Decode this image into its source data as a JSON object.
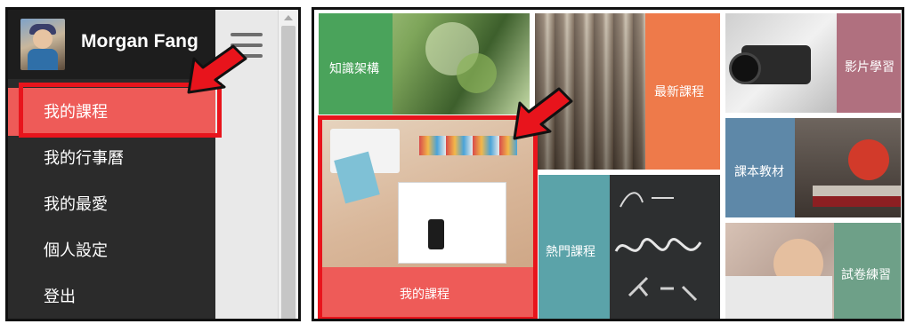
{
  "user": {
    "name": "Morgan Fang"
  },
  "menu": {
    "items": [
      {
        "label": "我的課程",
        "active": true
      },
      {
        "label": "我的行事曆",
        "active": false
      },
      {
        "label": "我的最愛",
        "active": false
      },
      {
        "label": "個人設定",
        "active": false
      },
      {
        "label": "登出",
        "active": false
      }
    ]
  },
  "tiles": {
    "knowledge": "知識架構",
    "new_courses": "最新課程",
    "video": "影片學習",
    "my_courses": "我的課程",
    "textbooks": "課本教材",
    "popular": "熱門課程",
    "exam": "試卷練習"
  },
  "colors": {
    "menu_bg": "#2b2b2b",
    "active_item": "#ee5b58",
    "highlight_red": "#e8141c",
    "tile_green": "#4aa35b",
    "tile_orange": "#ee7a4a",
    "tile_mauve": "#b0707f",
    "tile_blue": "#5e88a8",
    "tile_teal": "#5ba3a9",
    "tile_sage": "#6ea088"
  },
  "icons": {
    "menu": "hamburger-icon",
    "pointer": "red-arrow-icon"
  }
}
